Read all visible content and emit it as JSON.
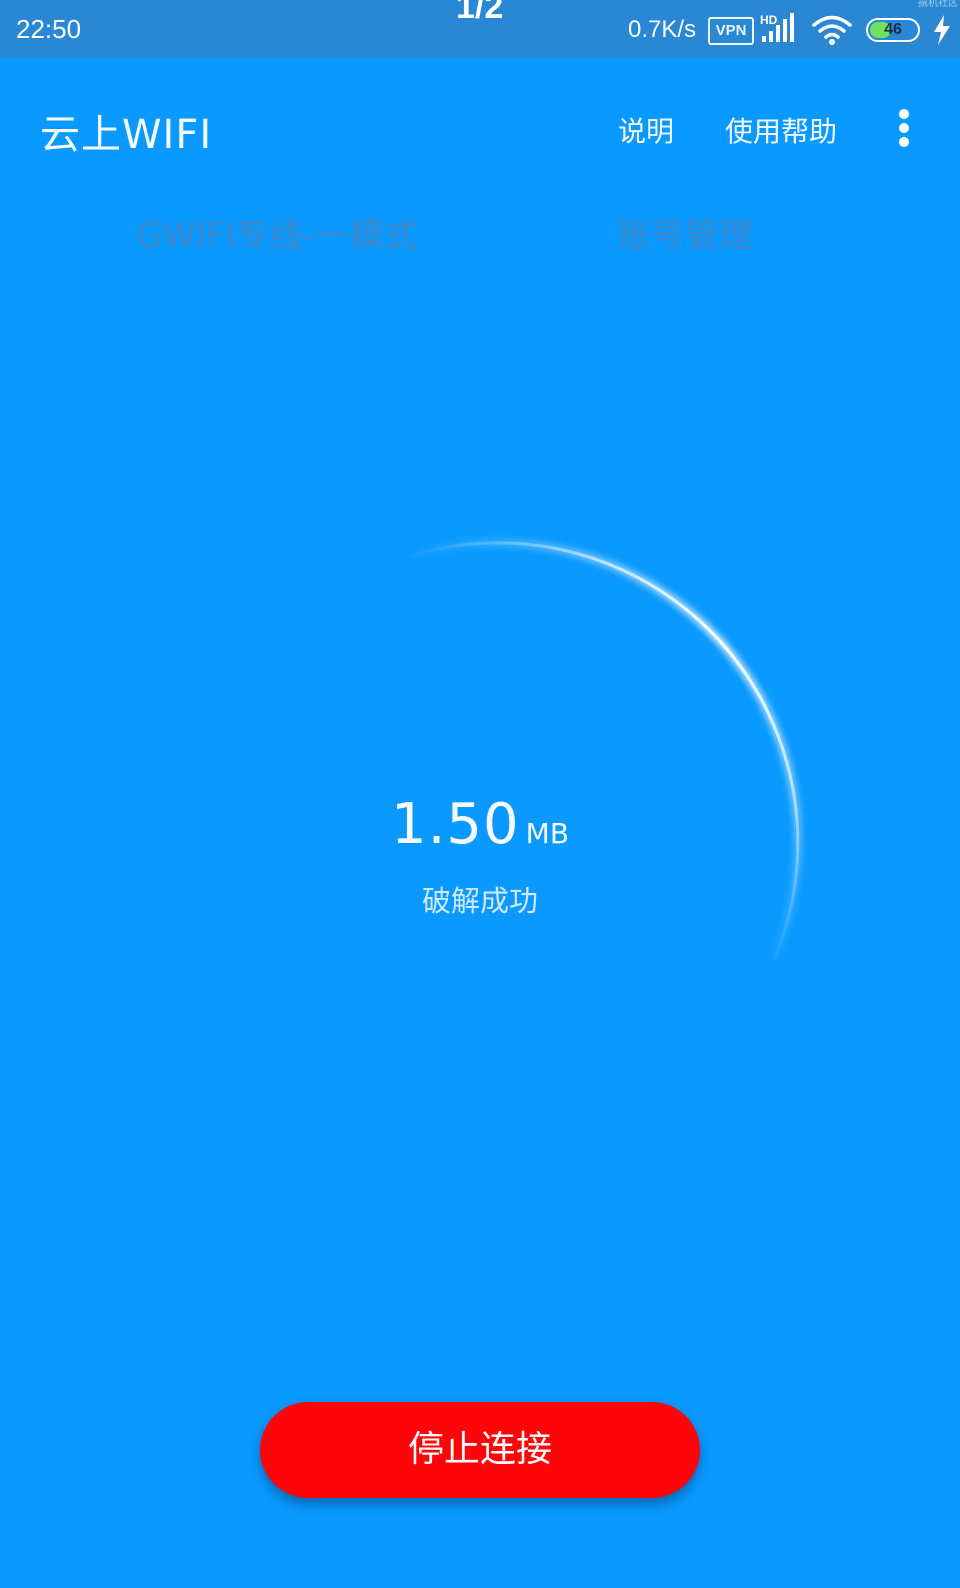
{
  "status_bar": {
    "time": "22:50",
    "page_indicator": "1/2",
    "network_speed": "0.7K/s",
    "vpn_label": "VPN",
    "signal_label": "HD",
    "battery_level": "46",
    "battery_fraction": 0.46,
    "icons": [
      "vpn-icon",
      "signal-icon",
      "wifi-icon",
      "battery-icon",
      "charging-icon"
    ]
  },
  "watermark": "搞机社区",
  "app_bar": {
    "title": "云上WIFI",
    "actions": [
      {
        "label": "说明"
      },
      {
        "label": "使用帮助"
      }
    ],
    "menu_icon": "more-vertical-icon"
  },
  "tabs": [
    {
      "label": "GWIFI专线-一模式"
    },
    {
      "label": "账号管理"
    }
  ],
  "gauge": {
    "value": "1.50",
    "unit": "MB",
    "status": "破解成功"
  },
  "stop_button": {
    "label": "停止连接"
  },
  "colors": {
    "background": "#0a9aff",
    "status_bar": "#2a87d3",
    "tab_inactive": "#4289cb",
    "button": "#ff0509",
    "battery_fill": "#6fe25c"
  }
}
